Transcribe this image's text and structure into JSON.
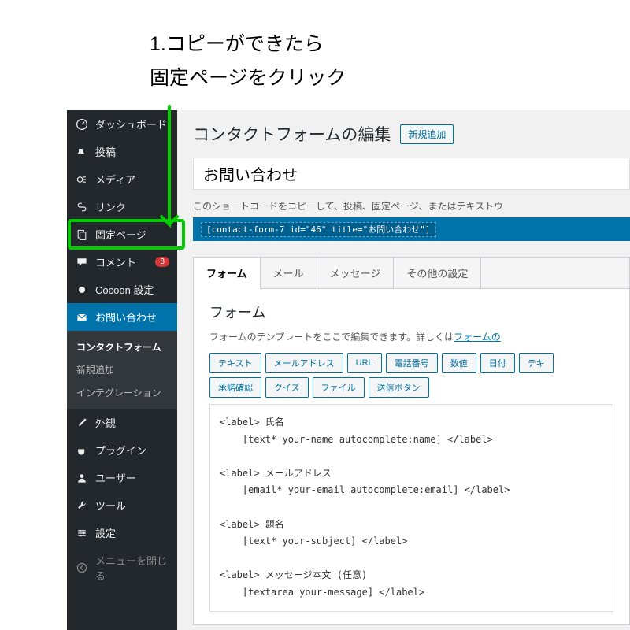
{
  "annotation": {
    "line1": "1.コピーができたら",
    "line2": "固定ページをクリック"
  },
  "sidebar": {
    "items": [
      {
        "label": "ダッシュボード",
        "icon": "dashboard"
      },
      {
        "label": "投稿",
        "icon": "pin"
      },
      {
        "label": "メディア",
        "icon": "media"
      },
      {
        "label": "リンク",
        "icon": "link"
      },
      {
        "label": "固定ページ",
        "icon": "page"
      },
      {
        "label": "コメント",
        "icon": "comment",
        "badge": "8"
      },
      {
        "label": "Cocoon 設定",
        "icon": "cocoon"
      },
      {
        "label": "お問い合わせ",
        "icon": "mail",
        "active": true
      }
    ],
    "sub": [
      {
        "label": "コンタクトフォーム",
        "current": true
      },
      {
        "label": "新規追加"
      },
      {
        "label": "インテグレーション"
      }
    ],
    "lower": [
      {
        "label": "外観",
        "icon": "brush"
      },
      {
        "label": "プラグイン",
        "icon": "plugin"
      },
      {
        "label": "ユーザー",
        "icon": "user"
      },
      {
        "label": "ツール",
        "icon": "tool"
      },
      {
        "label": "設定",
        "icon": "settings"
      }
    ],
    "collapse": "メニューを閉じる"
  },
  "main": {
    "title": "コンタクトフォームの編集",
    "add_new": "新規追加",
    "form_title": "お問い合わせ",
    "help_text": "このショートコードをコピーして、投稿、固定ページ、またはテキストウ",
    "shortcode": "[contact-form-7 id=\"46\" title=\"お問い合わせ\"]",
    "tabs": [
      {
        "label": "フォーム",
        "active": true
      },
      {
        "label": "メール"
      },
      {
        "label": "メッセージ"
      },
      {
        "label": "その他の設定"
      }
    ],
    "panel": {
      "heading": "フォーム",
      "desc_pre": "フォームのテンプレートをここで編集できます。詳しくは",
      "desc_link": "フォームの",
      "tag_row1": [
        "テキスト",
        "メールアドレス",
        "URL",
        "電話番号",
        "数値",
        "日付",
        "テキ"
      ],
      "tag_row2": [
        "承諾確認",
        "クイズ",
        "ファイル",
        "送信ボタン"
      ],
      "code": "<label> 氏名\n    [text* your-name autocomplete:name] </label>\n\n<label> メールアドレス\n    [email* your-email autocomplete:email] </label>\n\n<label> 題名\n    [text* your-subject] </label>\n\n<label> メッセージ本文 (任意)\n    [textarea your-message] </label>"
    }
  }
}
